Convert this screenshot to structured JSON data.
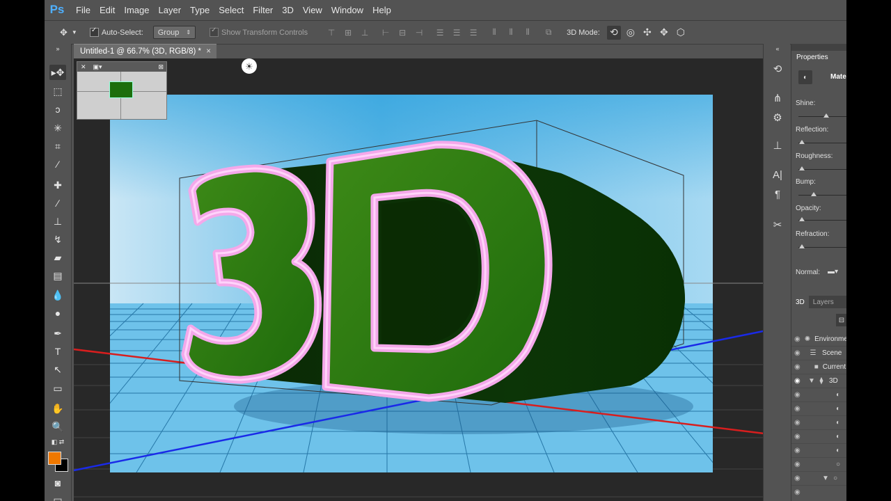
{
  "menu": {
    "logo": "Ps",
    "items": [
      "File",
      "Edit",
      "Image",
      "Layer",
      "Type",
      "Select",
      "Filter",
      "3D",
      "View",
      "Window",
      "Help"
    ]
  },
  "options": {
    "auto_select_label": "Auto-Select:",
    "auto_select_value": "Group",
    "show_transform_label": "Show Transform Controls",
    "mode_label": "3D Mode:"
  },
  "document": {
    "tab_title": "Untitled-1 @ 66.7% (3D, RGB/8) *",
    "close": "×",
    "artwork_text": "3D"
  },
  "colors": {
    "foreground": "#f07800",
    "background": "#000000",
    "letter_face": "#2c7a10",
    "letter_outline": "#f4a8ea"
  },
  "properties": {
    "tab": "Properties",
    "section": "Materials",
    "rows": [
      {
        "label": "Shine:",
        "level": 0.55
      },
      {
        "label": "Reflection:",
        "level": 0.02
      },
      {
        "label": "Roughness:",
        "level": 0.02
      },
      {
        "label": "Bump:",
        "level": 0.28
      },
      {
        "label": "Opacity:",
        "level": 0.02
      },
      {
        "label": "Refraction:",
        "level": 0.02
      }
    ],
    "normal_label": "Normal:"
  },
  "layers_panel": {
    "tabs": [
      "3D",
      "Layers"
    ],
    "items": [
      {
        "name": "Environment",
        "icon": "environment-icon"
      },
      {
        "name": "Scene",
        "icon": "scene-icon"
      },
      {
        "name": "Current View",
        "icon": "camera-icon"
      },
      {
        "name": "3D",
        "icon": "mesh-icon"
      },
      {
        "name": "",
        "icon": "material-icon"
      },
      {
        "name": "",
        "icon": "material-icon"
      },
      {
        "name": "",
        "icon": "material-icon"
      },
      {
        "name": "",
        "icon": "material-icon"
      },
      {
        "name": "",
        "icon": "material-icon"
      },
      {
        "name": "",
        "icon": "light-icon"
      },
      {
        "name": "",
        "icon": "light-icon"
      }
    ]
  }
}
